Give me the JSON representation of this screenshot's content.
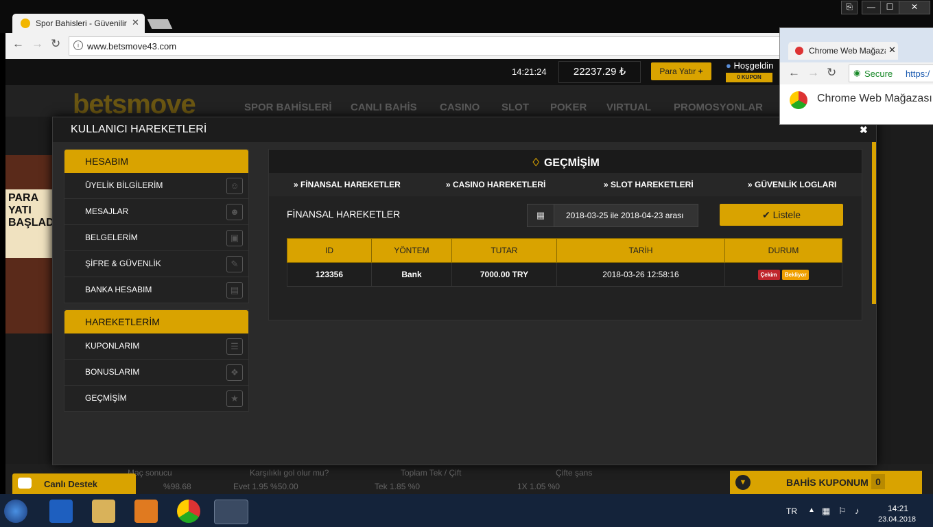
{
  "browser": {
    "tab_title": "Spor Bahisleri - Güvenilir",
    "tab_close": "✕",
    "url": "www.betsmove43.com",
    "window_controls": [
      "⎘",
      "—",
      "☐",
      "✕"
    ]
  },
  "site": {
    "clock": "14:21:24",
    "balance": "22237.29 ₺",
    "deposit_label": "Para Yatır",
    "welcome": "Hoşgeldin",
    "coupon_count_label": "0 KUPON",
    "logo": "betsmove",
    "nav": [
      "SPOR BAHİSLERİ",
      "CANLI BAHİS",
      "CASINO",
      "SLOT",
      "POKER",
      "VIRTUAL",
      "PROMOSYONLAR"
    ],
    "banner_text": "PARA YATI BAŞLADI",
    "bottom_markets": [
      {
        "label": "Maç sonucu",
        "odds": "%98.68"
      },
      {
        "label": "Karşılıklı gol olur mu?",
        "odds": "Evet   1.95   %50.00"
      },
      {
        "label": "Toplam Tek / Çift",
        "odds": "Tek   1.85   %0"
      },
      {
        "label": "Çifte şans",
        "odds": "1X   1.05   %0"
      }
    ]
  },
  "modal": {
    "title": "KULLANICI HAREKETLERİ",
    "close": "✖",
    "sidebar": {
      "account_heading": "HESABIM",
      "account_items": [
        {
          "label": "ÜYELİK BİLGİLERİM",
          "icon": "user-icon"
        },
        {
          "label": "MESAJLAR",
          "icon": "chat-icon"
        },
        {
          "label": "BELGELERİM",
          "icon": "image-icon"
        },
        {
          "label": "ŞİFRE & GÜVENLİK",
          "icon": "edit-icon"
        },
        {
          "label": "BANKA HESABIM",
          "icon": "bank-icon"
        }
      ],
      "activity_heading": "HAREKETLERİM",
      "activity_items": [
        {
          "label": "KUPONLARIM",
          "icon": "receipt-icon"
        },
        {
          "label": "BONUSLARIM",
          "icon": "gift-icon"
        },
        {
          "label": "GEÇMİŞİM",
          "icon": "trophy-icon"
        }
      ]
    },
    "panel": {
      "title": "GEÇMİŞİM",
      "subtabs": [
        "FİNANSAL HAREKETLER",
        "CASINO HAREKETLERİ",
        "SLOT HAREKETLERİ",
        "GÜVENLİK LOGLARI"
      ],
      "section_title": "FİNANSAL HAREKETLER",
      "date_range": "2018-03-25 ile 2018-04-23 arası",
      "list_button": "Listele",
      "columns": [
        "ID",
        "YÖNTEM",
        "TUTAR",
        "TARİH",
        "DURUM"
      ],
      "rows": [
        {
          "id": "123356",
          "method": "Bank",
          "amount": "7000.00 TRY",
          "date": "2018-03-26 12:58:16",
          "status_type": "Çekim",
          "status": "Bekliyor"
        }
      ]
    }
  },
  "second_window": {
    "tab_title": "Chrome Web Mağaza",
    "secure_label": "Secure",
    "url": "https:/",
    "page_title": "Chrome Web Mağazası"
  },
  "chat_label": "Canlı Destek",
  "coupon_bar": {
    "label": "BAHİS KUPONUM",
    "count": "0"
  },
  "taskbar": {
    "lang": "TR",
    "time": "14:21",
    "date": "23.04.2018"
  },
  "colors": {
    "accent": "#d9a300",
    "status_withdraw": "#c0262d",
    "status_pending": "#f0a000"
  }
}
